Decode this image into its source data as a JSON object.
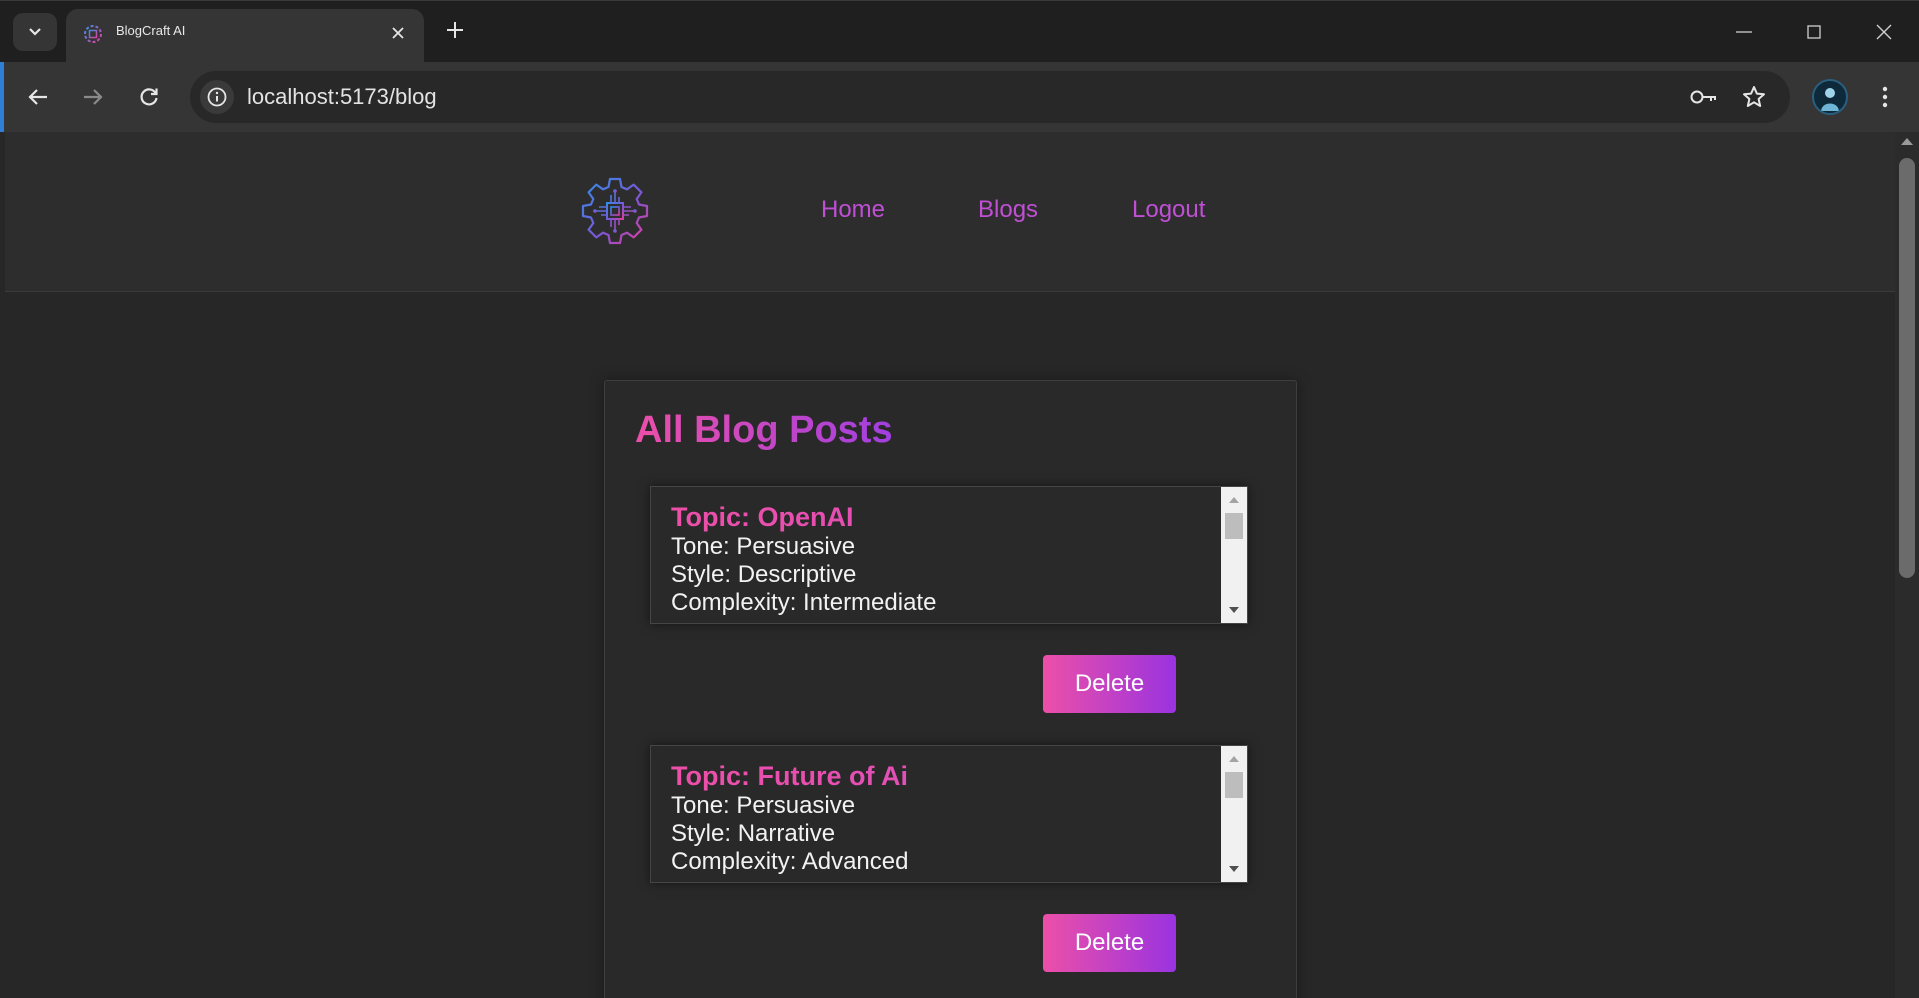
{
  "browser": {
    "tab": {
      "title": "BlogCraft AI",
      "favicon": "blogcraft-logo-icon"
    },
    "address_bar": {
      "url": "localhost:5173/blog"
    },
    "icons": {
      "tab_search": "chevron-down-icon",
      "tab_close": "close-icon",
      "new_tab": "plus-icon",
      "back": "arrow-left-icon",
      "forward": "arrow-right-icon",
      "reload": "reload-icon",
      "site_info": "info-icon",
      "passwords": "key-icon",
      "bookmark": "star-icon",
      "profile": "avatar",
      "menu": "kebab-menu-icon",
      "minimize": "minimize-icon",
      "maximize": "maximize-icon",
      "close_window": "close-icon"
    }
  },
  "site": {
    "nav": {
      "home": "Home",
      "blogs": "Blogs",
      "logout": "Logout"
    },
    "accent_gradient": [
      "#ec4fa8",
      "#9a33e0"
    ],
    "link_color": "#c04fd6"
  },
  "page": {
    "title": "All Blog Posts",
    "posts": [
      {
        "topic": "Topic: OpenAI",
        "tone": "Tone: Persuasive",
        "style": "Style: Descriptive",
        "complexity": "Complexity: Intermediate",
        "delete_label": "Delete"
      },
      {
        "topic": "Topic: Future of Ai",
        "tone": "Tone: Persuasive",
        "style": "Style: Narrative",
        "complexity": "Complexity: Advanced",
        "delete_label": "Delete"
      }
    ]
  }
}
